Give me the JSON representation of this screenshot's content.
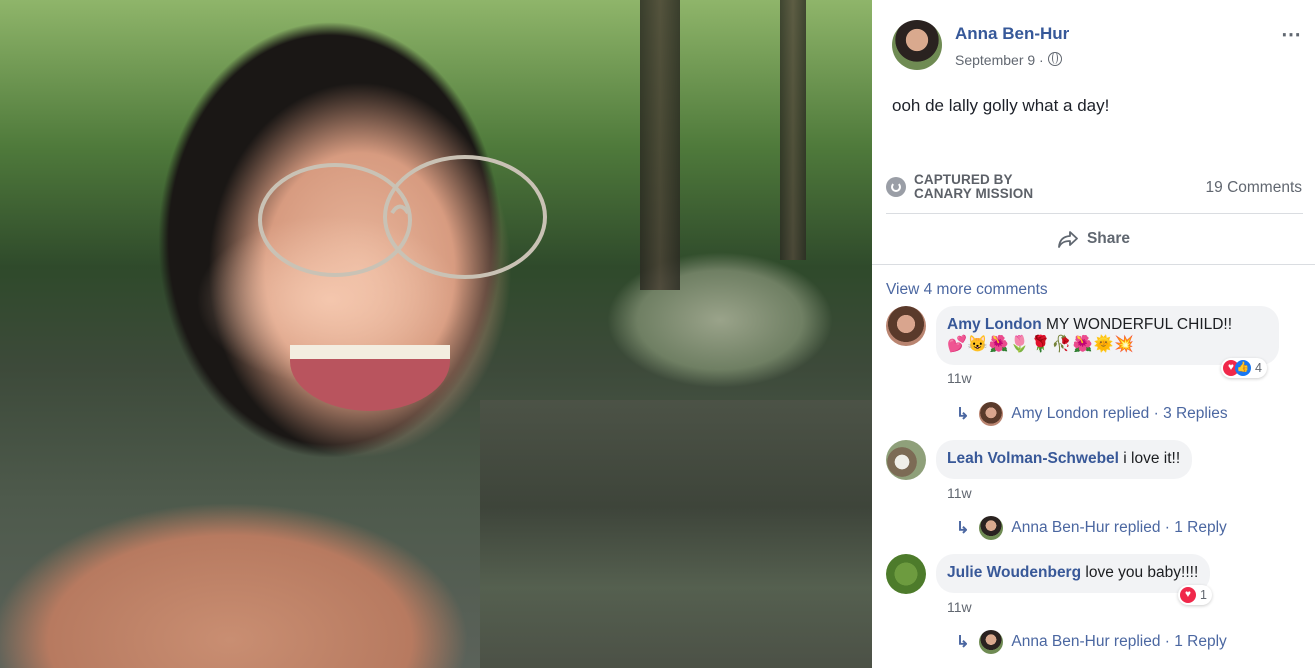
{
  "post": {
    "author": "Anna Ben-Hur",
    "date": "September 9 ·",
    "text": "ooh de lally golly what a day!",
    "captured_line1": "CAPTURED BY",
    "captured_line2": "CANARY MISSION",
    "comments_count": "19 Comments",
    "share_label": "Share",
    "more_icon": "⋯"
  },
  "comments": {
    "view_more": "View 4 more comments",
    "items": [
      {
        "name": "Amy London",
        "text": "MY WONDERFUL CHILD!!",
        "emojis": "💕😺🌺🌷🌹🥀🌺🌞💥",
        "time": "11w",
        "reactions": "4",
        "reply_author": "Amy London replied",
        "reply_sep": " · ",
        "reply_count": "3 Replies"
      },
      {
        "name": "Leah Volman-Schwebel",
        "text": "i love it!!",
        "time": "11w",
        "reply_author": "Anna Ben-Hur replied",
        "reply_sep": " · ",
        "reply_count": "1 Reply"
      },
      {
        "name": "Julie Woudenberg",
        "text": "love you baby!!!!",
        "time": "11w",
        "reactions": "1",
        "reply_author": "Anna Ben-Hur replied",
        "reply_sep": " · ",
        "reply_count": "1 Reply"
      }
    ]
  },
  "colors": {
    "link": "#365899",
    "heart": "#f0284a",
    "like": "#1877f2"
  }
}
